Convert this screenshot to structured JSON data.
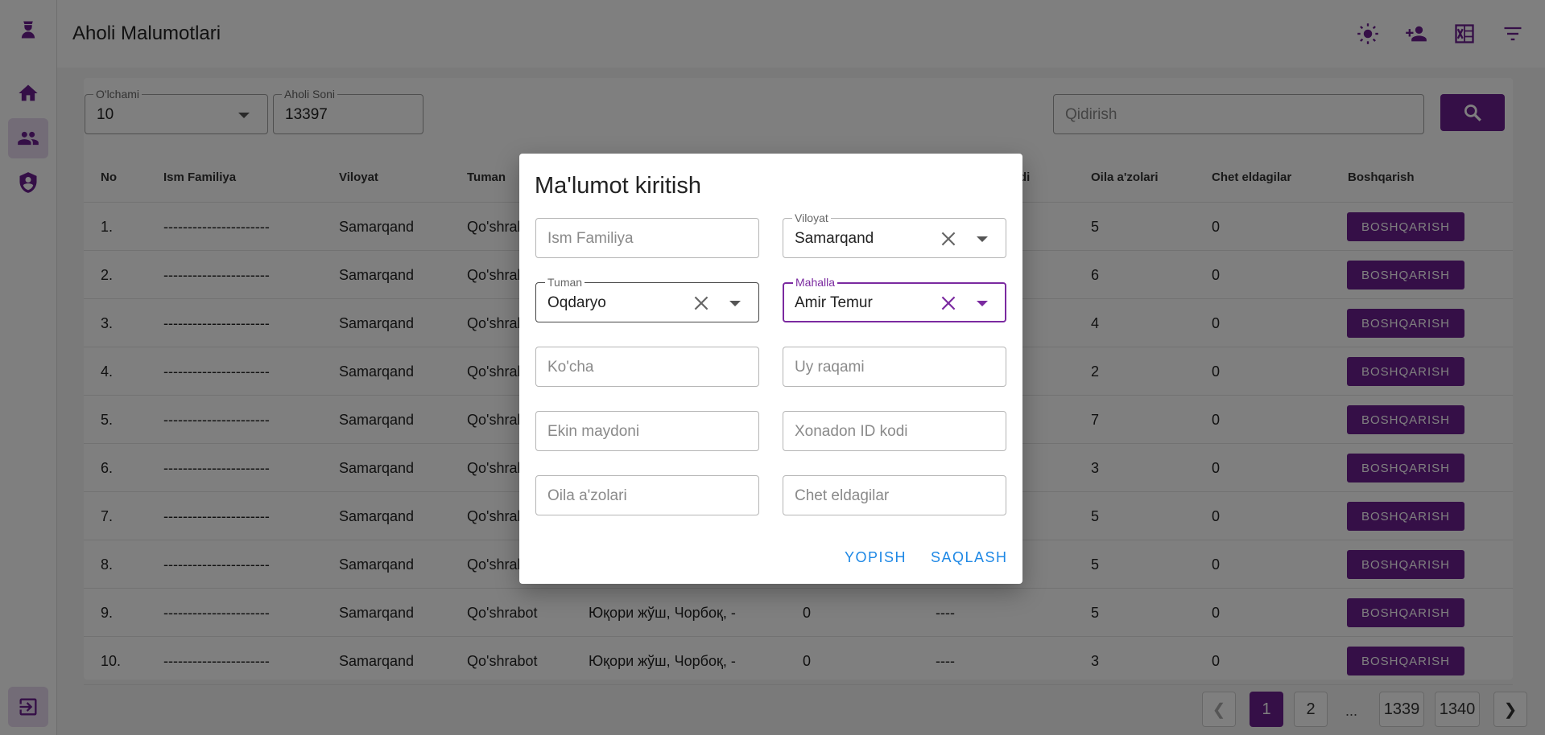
{
  "app": {
    "title": "Aholi Malumotlari"
  },
  "colors": {
    "accent": "#6b1f8f",
    "link": "#1e88e5"
  },
  "filters": {
    "size_label": "O'lchami",
    "size_value": "10",
    "count_label": "Aholi Soni",
    "count_value": "13397",
    "search_placeholder": "Qidirish"
  },
  "table": {
    "columns": [
      "No",
      "Ism Familiya",
      "Viloyat",
      "Tuman",
      "di",
      "Oila a'zolari",
      "Chet eldagilar",
      "Boshqarish"
    ],
    "action_label": "BOSHQARISH",
    "rows": [
      {
        "no": "1.",
        "name": "----------------------",
        "viloyat": "Samarqand",
        "tuman": "Qo'shrab",
        "mahalla": "",
        "c5": "",
        "c6": "",
        "oila": "5",
        "chet": "0"
      },
      {
        "no": "2.",
        "name": "----------------------",
        "viloyat": "Samarqand",
        "tuman": "Qo'shrab",
        "mahalla": "",
        "c5": "",
        "c6": "",
        "oila": "6",
        "chet": "0"
      },
      {
        "no": "3.",
        "name": "----------------------",
        "viloyat": "Samarqand",
        "tuman": "Qo'shrab",
        "mahalla": "",
        "c5": "",
        "c6": "",
        "oila": "4",
        "chet": "0"
      },
      {
        "no": "4.",
        "name": "----------------------",
        "viloyat": "Samarqand",
        "tuman": "Qo'shrab",
        "mahalla": "",
        "c5": "",
        "c6": "",
        "oila": "2",
        "chet": "0"
      },
      {
        "no": "5.",
        "name": "----------------------",
        "viloyat": "Samarqand",
        "tuman": "Qo'shrab",
        "mahalla": "",
        "c5": "",
        "c6": "",
        "oila": "7",
        "chet": "0"
      },
      {
        "no": "6.",
        "name": "----------------------",
        "viloyat": "Samarqand",
        "tuman": "Qo'shrab",
        "mahalla": "",
        "c5": "",
        "c6": "",
        "oila": "3",
        "chet": "0"
      },
      {
        "no": "7.",
        "name": "----------------------",
        "viloyat": "Samarqand",
        "tuman": "Qo'shrab",
        "mahalla": "",
        "c5": "",
        "c6": "",
        "oila": "5",
        "chet": "0"
      },
      {
        "no": "8.",
        "name": "----------------------",
        "viloyat": "Samarqand",
        "tuman": "Qo'shrab",
        "mahalla": "",
        "c5": "",
        "c6": "",
        "oila": "5",
        "chet": "0"
      },
      {
        "no": "9.",
        "name": "----------------------",
        "viloyat": "Samarqand",
        "tuman": "Qo'shrabot",
        "mahalla": "Юқори жўш, Чорбоқ, -",
        "c5": "0",
        "c6": "----",
        "oila": "5",
        "chet": "0"
      },
      {
        "no": "10.",
        "name": "----------------------",
        "viloyat": "Samarqand",
        "tuman": "Qo'shrabot",
        "mahalla": "Юқори жўш, Чорбоқ, -",
        "c5": "0",
        "c6": "----",
        "oila": "3",
        "chet": "0"
      }
    ]
  },
  "pagination": {
    "pages": [
      "1",
      "2",
      "1339",
      "1340"
    ],
    "ellipsis": "...",
    "current": "1"
  },
  "dialog": {
    "title": "Ma'lumot kiritish",
    "fields": {
      "ism": {
        "placeholder": "Ism Familiya"
      },
      "viloyat": {
        "label": "Viloyat",
        "value": "Samarqand"
      },
      "tuman": {
        "label": "Tuman",
        "value": "Oqdaryo"
      },
      "mahalla": {
        "label": "Mahalla",
        "value": "Amir Temur"
      },
      "kocha": {
        "placeholder": "Ko'cha"
      },
      "uy": {
        "placeholder": "Uy raqami"
      },
      "ekin": {
        "placeholder": "Ekin maydoni"
      },
      "xonadon": {
        "placeholder": "Xonadon ID kodi"
      },
      "oila": {
        "placeholder": "Oila a'zolari"
      },
      "chet": {
        "placeholder": "Chet eldagilar"
      }
    },
    "close_label": "YOPISH",
    "save_label": "SAQLASH"
  },
  "icons": {
    "logo": "officer-icon",
    "home": "home-icon",
    "people": "people-icon",
    "security": "shield-icon",
    "logout": "logout-icon",
    "theme": "sun-icon",
    "add_user": "person-add-icon",
    "excel": "excel-icon",
    "filter": "filter-icon",
    "search": "search-icon"
  }
}
